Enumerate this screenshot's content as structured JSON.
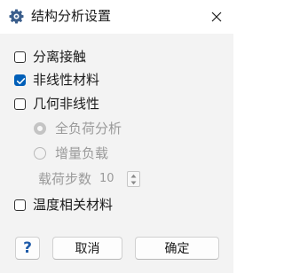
{
  "window": {
    "title": "结构分析设置",
    "icon": "gear-icon",
    "close_icon": "close-icon"
  },
  "options": {
    "separate_contact": {
      "label": "分离接触",
      "checked": false
    },
    "nonlinear_material": {
      "label": "非线性材料",
      "checked": true
    },
    "geometric_nonlinear": {
      "label": "几何非线性",
      "checked": false
    },
    "full_load_analysis": {
      "label": "全负荷分析",
      "selected": true,
      "enabled": false
    },
    "incremental_load": {
      "label": "增量负载",
      "selected": false,
      "enabled": false
    },
    "load_steps": {
      "label": "载荷步数",
      "value": "10",
      "enabled": false
    },
    "temperature_material": {
      "label": "温度相关材料",
      "checked": false
    }
  },
  "buttons": {
    "help_label": "?",
    "cancel_label": "取消",
    "ok_label": "确定"
  },
  "colors": {
    "accent": "#005fb8",
    "help_icon": "#1e5aa8",
    "disabled_text": "#9a9a9a"
  }
}
